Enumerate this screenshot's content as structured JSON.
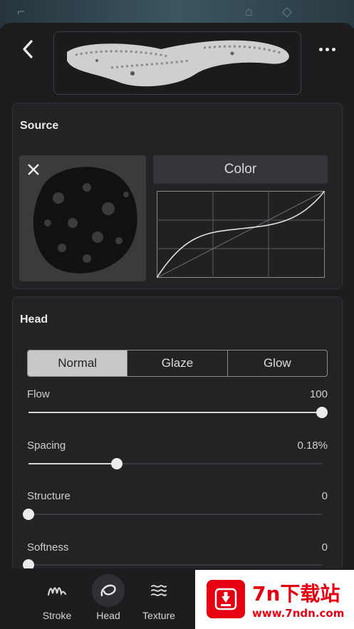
{
  "source": {
    "title": "Source",
    "color_label": "Color"
  },
  "head": {
    "title": "Head",
    "modes": [
      "Normal",
      "Glaze",
      "Glow"
    ],
    "selected_mode": "Normal",
    "sliders": [
      {
        "label": "Flow",
        "value": "100",
        "fraction": 1.0
      },
      {
        "label": "Spacing",
        "value": "0.18%",
        "fraction": 0.3
      },
      {
        "label": "Structure",
        "value": "0",
        "fraction": 0.0
      },
      {
        "label": "Softness",
        "value": "0",
        "fraction": 0.0
      }
    ]
  },
  "tabbar": {
    "items": [
      {
        "label": "Stroke",
        "icon": "stroke-icon"
      },
      {
        "label": "Head",
        "icon": "head-icon",
        "active": true
      },
      {
        "label": "Texture",
        "icon": "texture-icon"
      }
    ]
  },
  "watermark": {
    "logo_text": "7n下载站",
    "url_text": "www.7ndn.com"
  },
  "colors": {
    "accent": "#e60012",
    "knob": "#ececec",
    "background": "#1c1d1f"
  }
}
